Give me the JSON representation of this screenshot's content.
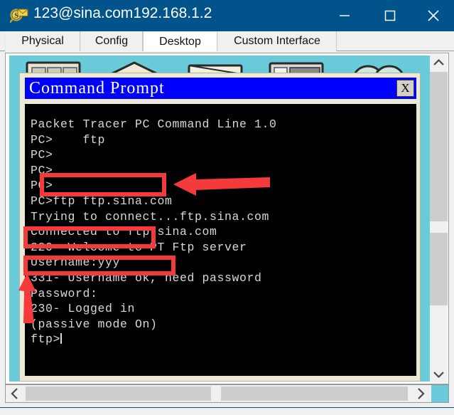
{
  "window": {
    "title": "123@sina.com192.168.1.2",
    "icon": "mail-magnifier-icon",
    "controls": {
      "minimize": "minimize-icon",
      "maximize": "maximize-icon",
      "close": "close-icon"
    }
  },
  "tabs": [
    {
      "label": "Physical",
      "active": false
    },
    {
      "label": "Config",
      "active": false
    },
    {
      "label": "Desktop",
      "active": true
    },
    {
      "label": "Custom Interface",
      "active": false
    }
  ],
  "desktop": {
    "background_color": "#69cada",
    "icons": [
      {
        "name": "desktop-icon-1"
      },
      {
        "name": "desktop-icon-2"
      },
      {
        "name": "desktop-icon-3"
      },
      {
        "name": "desktop-icon-4"
      },
      {
        "name": "desktop-icon-5"
      }
    ],
    "scrollbar": {
      "up_arrow": "chevron-up-icon",
      "down_arrow": "chevron-down-icon"
    }
  },
  "command_prompt": {
    "title": "Command Prompt",
    "title_bar_color": "#0000ff",
    "close_label": "X",
    "screen_bg": "#000000",
    "text_color": "#d8d8d8",
    "lines": [
      "Packet Tracer PC Command Line 1.0",
      "PC>    ftp",
      "PC>",
      "PC>",
      "PC>",
      "PC>ftp ftp.sina.com",
      "Trying to connect...ftp.sina.com",
      "Connected to ftp.sina.com",
      "220- Welcome to PT Ftp server",
      "Username:yyy",
      "331- Username ok, need password",
      "Password:",
      "230- Logged in",
      "(passive mode On)",
      "ftp>"
    ]
  },
  "annotations": {
    "color": "#f43a3a",
    "boxes": [
      {
        "name": "highlight-ftp-command",
        "target": "PC>ftp ftp.sina.com"
      },
      {
        "name": "highlight-username",
        "target": "Username:yyy"
      },
      {
        "name": "highlight-password",
        "target": "Password:"
      }
    ],
    "arrows": [
      {
        "name": "arrow-pointing-to-ftp-command",
        "direction": "left"
      },
      {
        "name": "arrow-pointing-to-ftp-prompt",
        "direction": "up"
      }
    ]
  },
  "horizontal_scrollbar": {
    "left_arrow": "chevron-left-icon",
    "right_arrow": "chevron-right-icon"
  }
}
